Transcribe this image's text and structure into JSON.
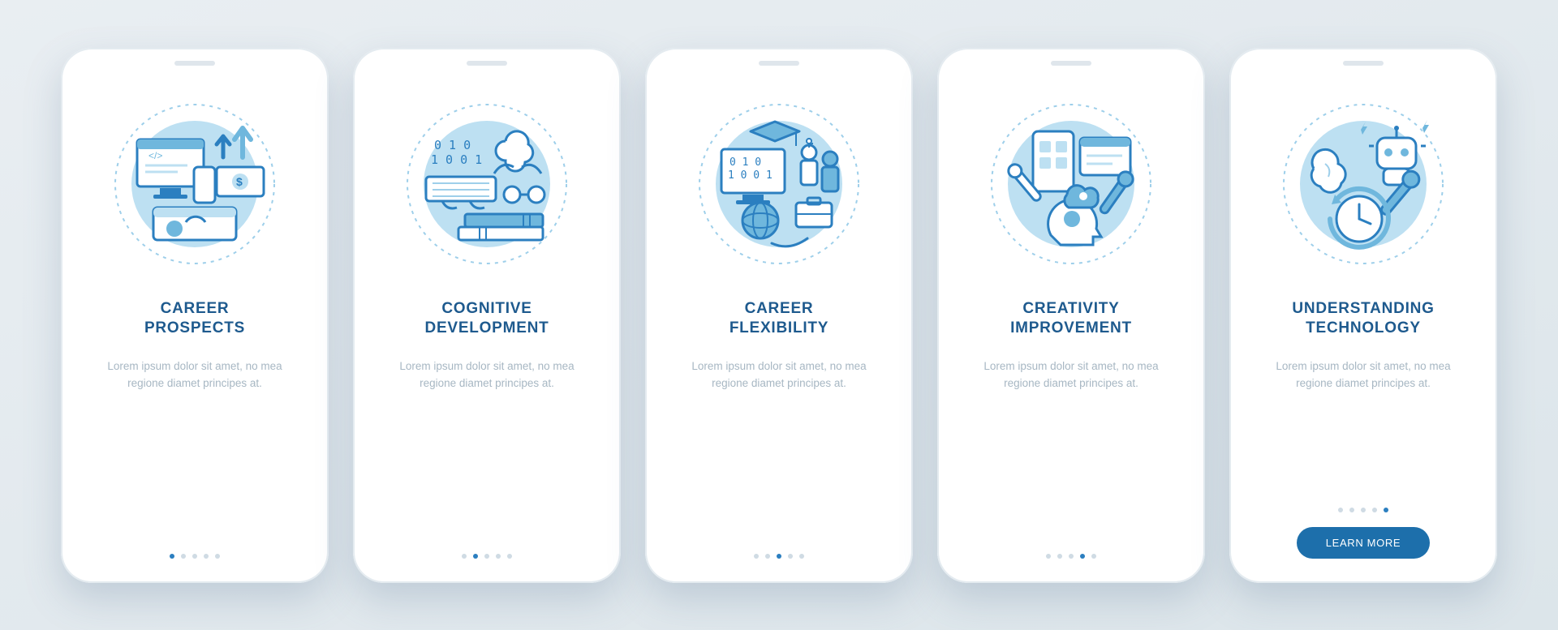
{
  "colors": {
    "primary": "#1e5a8e",
    "accent": "#2b7fc0",
    "lightBlue": "#bde0f2",
    "midBlue": "#6fb7dd"
  },
  "screens": [
    {
      "title_line1": "CAREER",
      "title_line2": "PROSPECTS",
      "description": "Lorem ipsum dolor sit amet, no mea regione diamet principes at.",
      "icon_name": "career-prospects-icon"
    },
    {
      "title_line1": "COGNITIVE",
      "title_line2": "DEVELOPMENT",
      "description": "Lorem ipsum dolor sit amet, no mea regione diamet principes at.",
      "icon_name": "cognitive-development-icon"
    },
    {
      "title_line1": "CAREER",
      "title_line2": "FLEXIBILITY",
      "description": "Lorem ipsum dolor sit amet, no mea regione diamet principes at.",
      "icon_name": "career-flexibility-icon"
    },
    {
      "title_line1": "CREATIVITY",
      "title_line2": "IMPROVEMENT",
      "description": "Lorem ipsum dolor sit amet, no mea regione diamet principes at.",
      "icon_name": "creativity-improvement-icon"
    },
    {
      "title_line1": "UNDERSTANDING",
      "title_line2": "TECHNOLOGY",
      "description": "Lorem ipsum dolor sit amet, no mea regione diamet principes at.",
      "icon_name": "understanding-technology-icon"
    }
  ],
  "cta_label": "LEARN MORE",
  "total_dots": 5
}
